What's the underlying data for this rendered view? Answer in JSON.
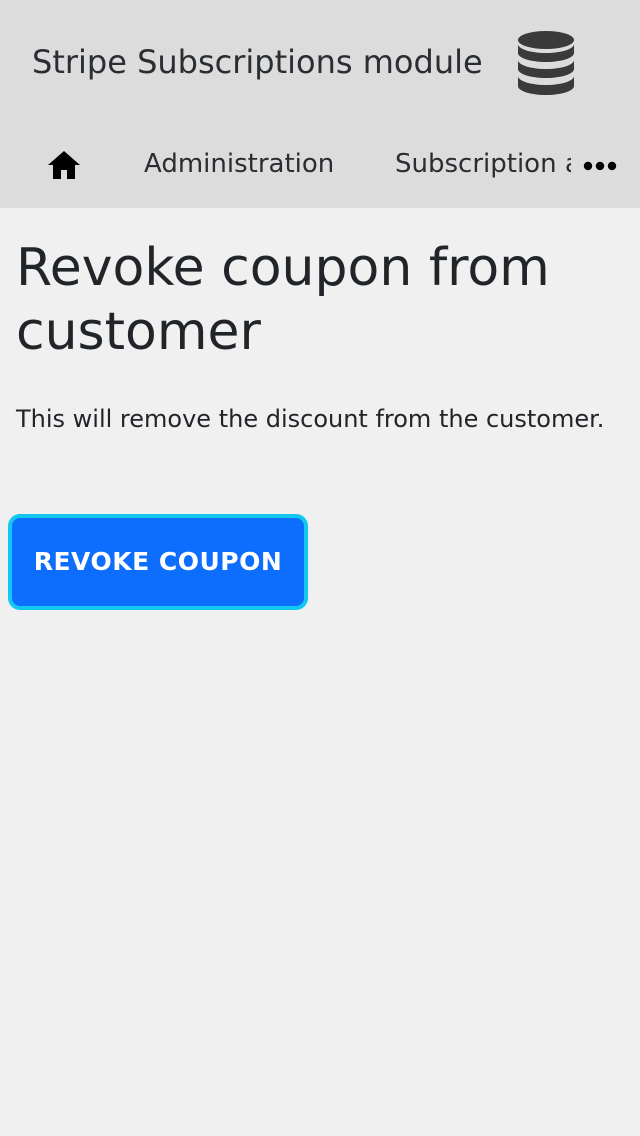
{
  "header": {
    "app_title": "Stripe Subscriptions module",
    "app_icon": "database-icon"
  },
  "nav": {
    "home_icon": "home-icon",
    "items": [
      {
        "label": "Administration"
      },
      {
        "label": "Subscription and coupons"
      }
    ],
    "more_icon": "more-horizontal-icon"
  },
  "main": {
    "title": "Revoke coupon from customer",
    "description": "This will remove the discount from the customer.",
    "revoke_button_label": "REVOKE COUPON"
  },
  "colors": {
    "topbar_bg": "#dcdcdc",
    "page_bg": "#f0f0f0",
    "primary": "#0d6efd",
    "focus_ring": "#13c8f0"
  }
}
